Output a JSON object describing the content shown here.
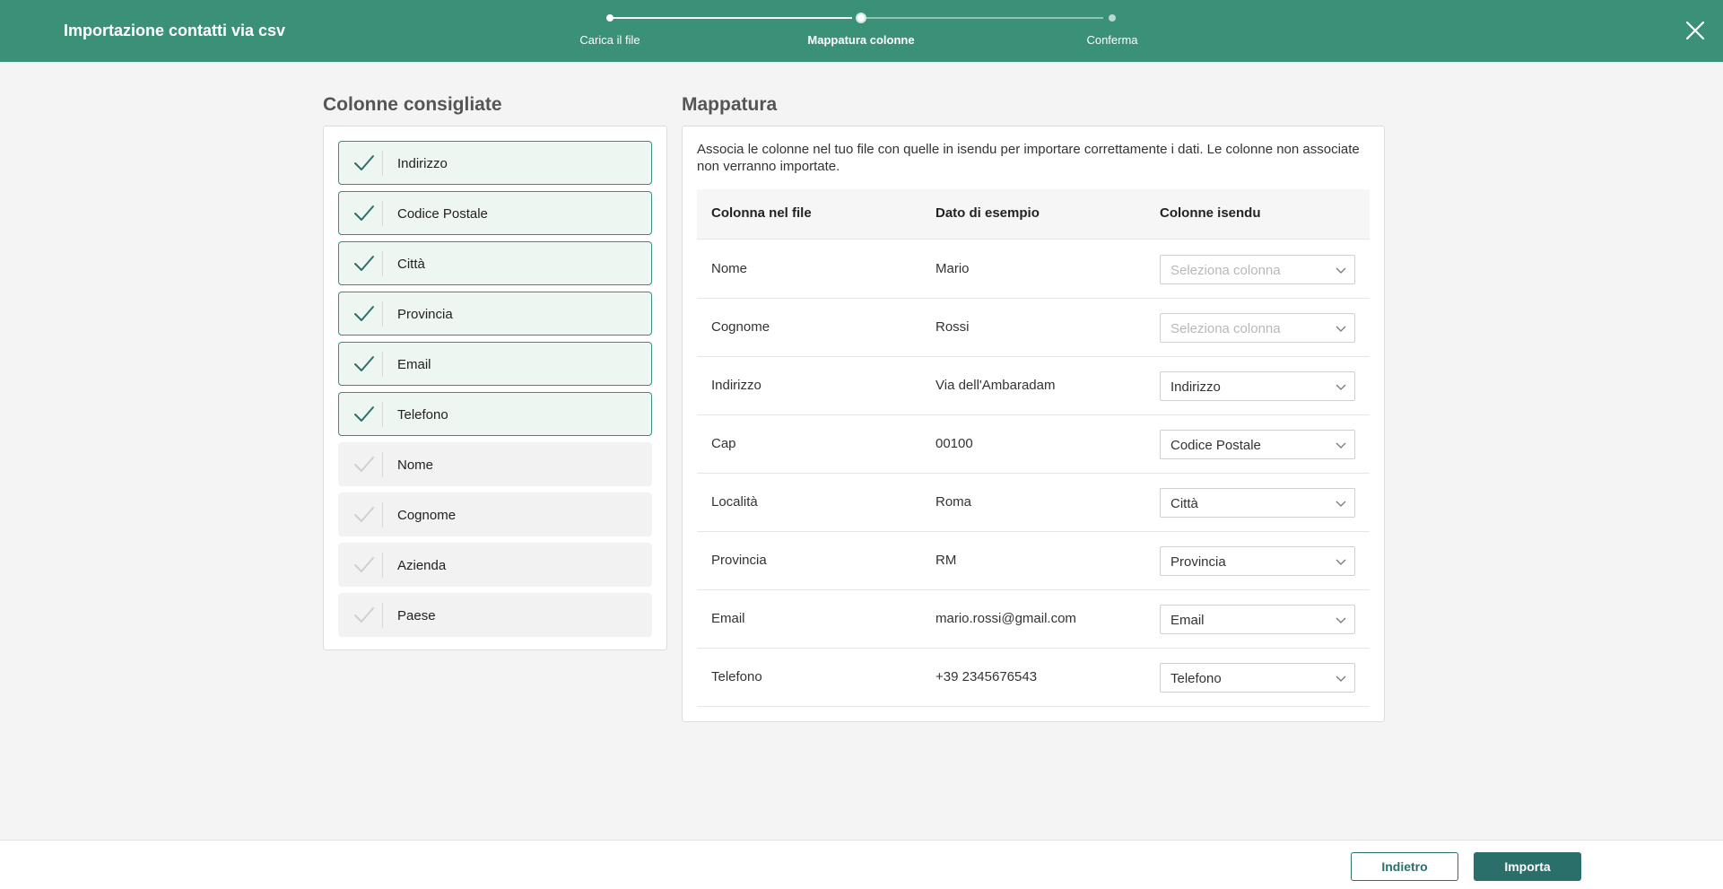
{
  "header": {
    "title": "Importazione contatti via csv",
    "close_icon": "close-icon"
  },
  "stepper": {
    "steps": [
      {
        "label": "Carica il file",
        "state": "done"
      },
      {
        "label": "Mappatura colonne",
        "state": "active"
      },
      {
        "label": "Conferma",
        "state": "todo"
      }
    ]
  },
  "recommended": {
    "title": "Colonne consigliate",
    "items": [
      {
        "label": "Indirizzo",
        "checked": true
      },
      {
        "label": "Codice Postale",
        "checked": true
      },
      {
        "label": "Città",
        "checked": true
      },
      {
        "label": "Provincia",
        "checked": true
      },
      {
        "label": "Email",
        "checked": true
      },
      {
        "label": "Telefono",
        "checked": true
      },
      {
        "label": "Nome",
        "checked": false
      },
      {
        "label": "Cognome",
        "checked": false
      },
      {
        "label": "Azienda",
        "checked": false
      },
      {
        "label": "Paese",
        "checked": false
      }
    ]
  },
  "mapping": {
    "title": "Mappatura",
    "description": "Associa le colonne nel tuo file con quelle in isendu per importare correttamente i dati. Le colonne non associate non verranno importate.",
    "columns": [
      "Colonna nel file",
      "Dato di esempio",
      "Colonne isendu"
    ],
    "placeholder": "Seleziona colonna",
    "rows": [
      {
        "file_column": "Nome",
        "example": "Mario",
        "isendu_column": ""
      },
      {
        "file_column": "Cognome",
        "example": "Rossi",
        "isendu_column": ""
      },
      {
        "file_column": "Indirizzo",
        "example": "Via dell'Ambaradam",
        "isendu_column": "Indirizzo"
      },
      {
        "file_column": "Cap",
        "example": "00100",
        "isendu_column": "Codice Postale"
      },
      {
        "file_column": "Località",
        "example": "Roma",
        "isendu_column": "Città"
      },
      {
        "file_column": "Provincia",
        "example": "RM",
        "isendu_column": "Provincia"
      },
      {
        "file_column": "Email",
        "example": "mario.rossi@gmail.com",
        "isendu_column": "Email"
      },
      {
        "file_column": "Telefono",
        "example": "+39 2345676543",
        "isendu_column": "Telefono"
      }
    ]
  },
  "footer": {
    "back_label": "Indietro",
    "import_label": "Importa"
  },
  "colors": {
    "brand": "#3a9178",
    "primary_button": "#2b6f6b",
    "checked_bg": "#eef6f2",
    "unchecked_bg": "#f2f2f2"
  }
}
